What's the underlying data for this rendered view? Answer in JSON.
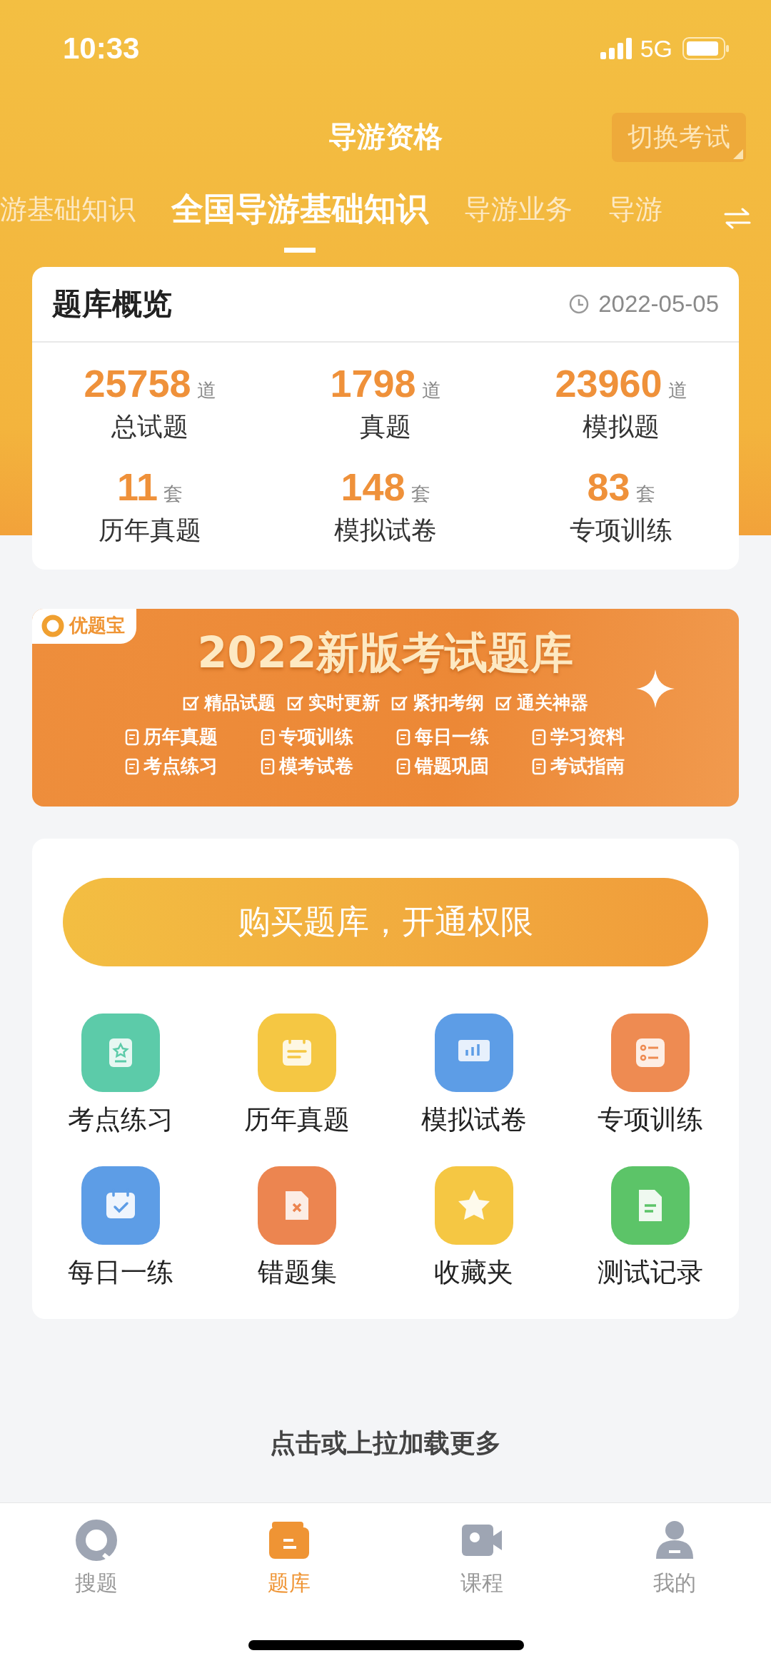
{
  "status_bar": {
    "time": "10:33",
    "network": "5G"
  },
  "header": {
    "title": "导游资格",
    "switch_button": "切换考试"
  },
  "subject_tabs": [
    {
      "label": "游基础知识",
      "selected": false
    },
    {
      "label": "全国导游基础知识",
      "selected": true
    },
    {
      "label": "导游业务",
      "selected": false
    },
    {
      "label": "导游",
      "selected": false
    }
  ],
  "overview": {
    "title": "题库概览",
    "date": "2022-05-05",
    "stats": [
      {
        "value": "25758",
        "unit": "道",
        "label": "总试题"
      },
      {
        "value": "1798",
        "unit": "道",
        "label": "真题"
      },
      {
        "value": "23960",
        "unit": "道",
        "label": "模拟题"
      },
      {
        "value": "11",
        "unit": "套",
        "label": "历年真题"
      },
      {
        "value": "148",
        "unit": "套",
        "label": "模拟试卷"
      },
      {
        "value": "83",
        "unit": "套",
        "label": "专项训练"
      }
    ]
  },
  "banner": {
    "brand": "优题宝",
    "headline": "2022新版考试题库",
    "tags": [
      "精品试题",
      "实时更新",
      "紧扣考纲",
      "通关神器"
    ],
    "items": [
      "历年真题",
      "专项训练",
      "每日一练",
      "学习资料",
      "考点练习",
      "模考试卷",
      "错题巩固",
      "考试指南"
    ]
  },
  "buy_button": "购买题库，开通权限",
  "features": [
    {
      "label": "考点练习",
      "kind": "practice",
      "color": "#5ccba9"
    },
    {
      "label": "历年真题",
      "kind": "papers",
      "color": "#f5c743"
    },
    {
      "label": "模拟试卷",
      "kind": "mock",
      "color": "#5d9de6"
    },
    {
      "label": "专项训练",
      "kind": "training",
      "color": "#ee8b52"
    },
    {
      "label": "每日一练",
      "kind": "daily",
      "color": "#5d9de6"
    },
    {
      "label": "错题集",
      "kind": "mistakes",
      "color": "#ec8550"
    },
    {
      "label": "收藏夹",
      "kind": "favorites",
      "color": "#f5c743"
    },
    {
      "label": "测试记录",
      "kind": "records",
      "color": "#5cc468"
    }
  ],
  "load_more": "点击或上拉加载更多",
  "tab_bar": [
    {
      "label": "搜题",
      "kind": "search",
      "selected": false
    },
    {
      "label": "题库",
      "kind": "bank",
      "selected": true
    },
    {
      "label": "课程",
      "kind": "course",
      "selected": false
    },
    {
      "label": "我的",
      "kind": "profile",
      "selected": false
    }
  ]
}
